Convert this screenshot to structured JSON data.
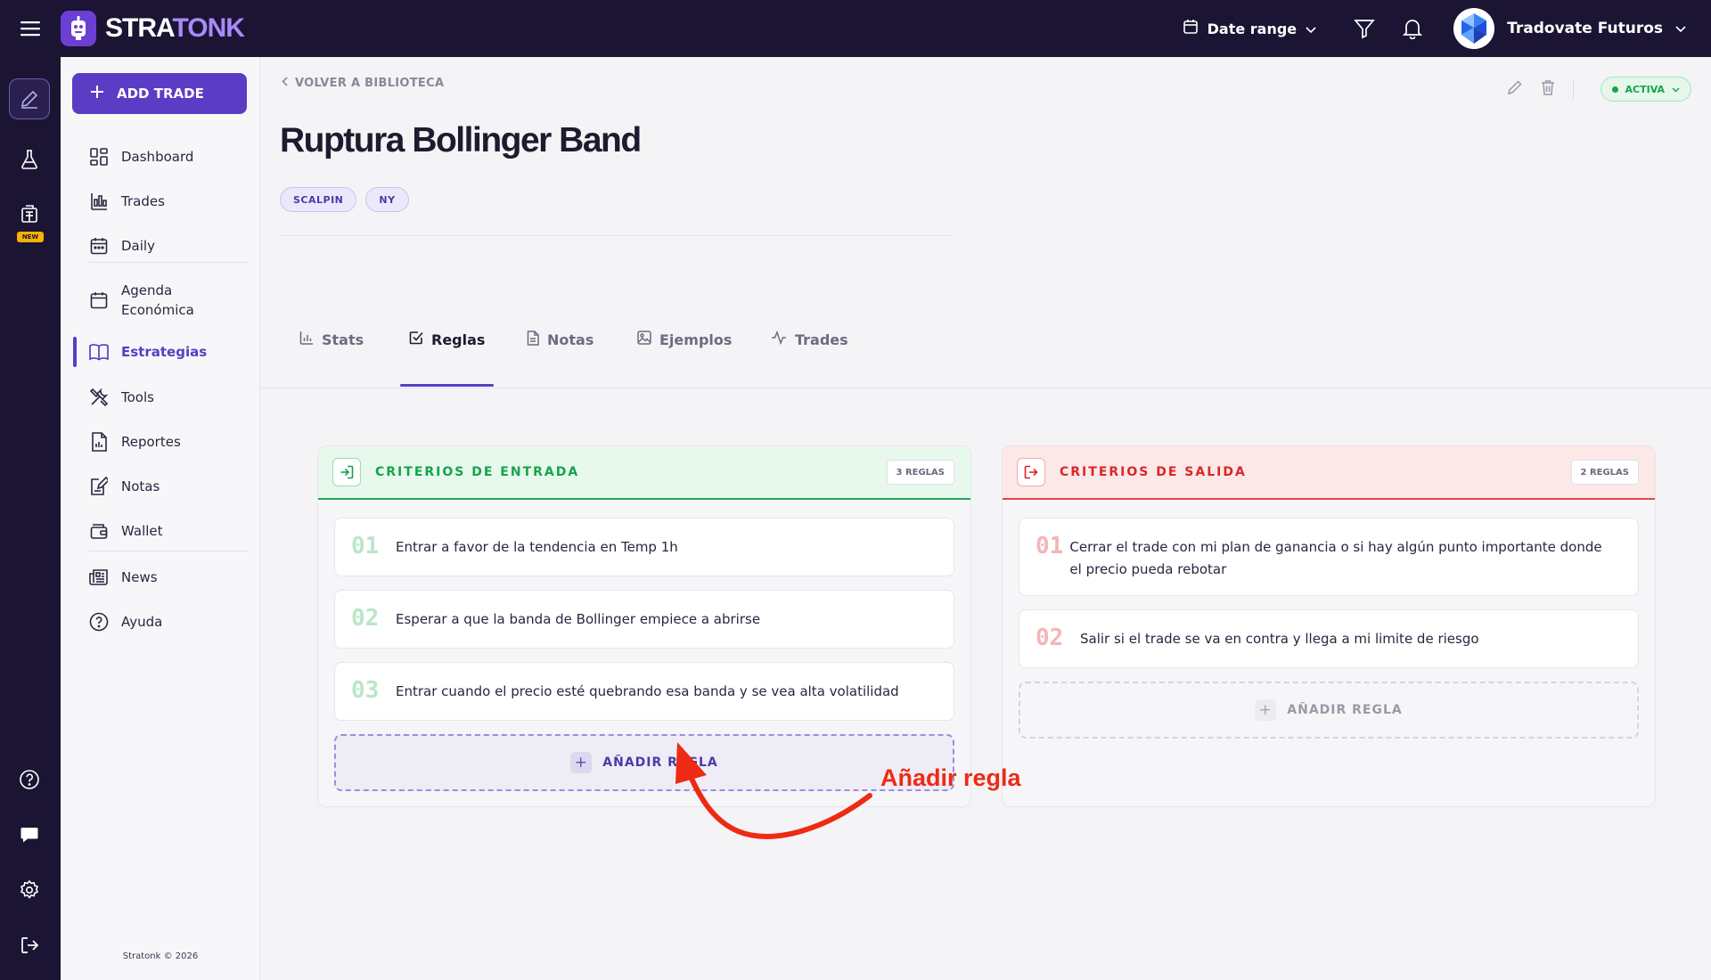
{
  "app": {
    "brand_part1": "STRA",
    "brand_part2": "TONK",
    "footer": "Stratonk © 2026"
  },
  "topbar": {
    "date_range_label": "Date range",
    "account_name": "Tradovate Futuros"
  },
  "rail": {
    "new_badge": "NEW"
  },
  "sidebar": {
    "add_trade_label": "ADD TRADE",
    "items": [
      {
        "label": "Dashboard",
        "icon": "dashboard-icon"
      },
      {
        "label": "Trades",
        "icon": "chart-bars-icon"
      },
      {
        "label": "Daily",
        "icon": "calendar-icon"
      },
      {
        "label": "Agenda",
        "label2": "Económica",
        "icon": "calendar-icon"
      },
      {
        "label": "Estrategias",
        "icon": "book-icon",
        "active": true
      },
      {
        "label": "Tools",
        "icon": "tools-icon"
      },
      {
        "label": "Reportes",
        "icon": "report-icon"
      },
      {
        "label": "Notas",
        "icon": "notes-icon"
      },
      {
        "label": "Wallet",
        "icon": "wallet-icon"
      },
      {
        "label": "News",
        "icon": "news-icon"
      },
      {
        "label": "Ayuda",
        "icon": "help-icon"
      }
    ]
  },
  "strategy": {
    "back_label": "VOLVER A BIBLIOTECA",
    "title": "Ruptura Bollinger Band",
    "tags": [
      "SCALPIN",
      "NY"
    ],
    "status": "ACTIVA"
  },
  "tabs": [
    {
      "label": "Stats",
      "icon": "bar-chart-icon"
    },
    {
      "label": "Reglas",
      "icon": "checkbox-icon",
      "active": true
    },
    {
      "label": "Notas",
      "icon": "document-icon"
    },
    {
      "label": "Ejemplos",
      "icon": "image-icon"
    },
    {
      "label": "Trades",
      "icon": "activity-icon"
    }
  ],
  "entry": {
    "title": "CRITERIOS DE ENTRADA",
    "count": "3 REGLAS",
    "rules": [
      {
        "num": "01",
        "text": "Entrar a favor de la tendencia en Temp 1h"
      },
      {
        "num": "02",
        "text": "Esperar a que la banda de Bollinger empiece a abrirse"
      },
      {
        "num": "03",
        "text": "Entrar cuando el precio esté quebrando esa banda y se vea alta volatilidad"
      }
    ],
    "add_label": "AÑADIR REGLA"
  },
  "exit": {
    "title": "CRITERIOS DE SALIDA",
    "count": "2 REGLAS",
    "rules": [
      {
        "num": "01",
        "text": "Cerrar el trade con mi plan de ganancia o si hay algún punto importante donde el precio pueda rebotar"
      },
      {
        "num": "02",
        "text": "Salir si el trade se va en contra y llega a mi limite de riesgo"
      }
    ],
    "add_label": "AÑADIR REGLA"
  },
  "annotation": {
    "text": "Añadir regla",
    "color": "#ee2a14"
  },
  "colors": {
    "accent": "#5b3cc4",
    "topbar": "#1c1433",
    "entry": "#16a34a",
    "exit": "#dc2626"
  }
}
